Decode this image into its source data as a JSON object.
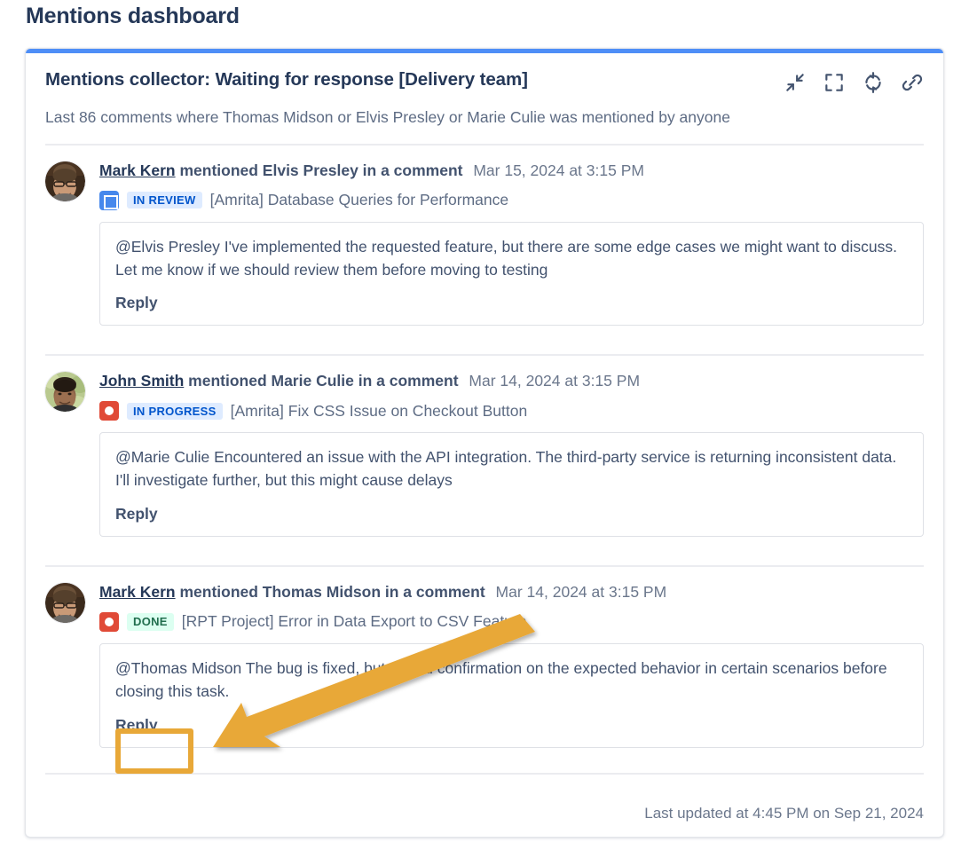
{
  "page": {
    "title": "Mentions dashboard",
    "accent_blue": "#4e8ef7"
  },
  "gadget": {
    "title": "Mentions collector: Waiting for response [Delivery team]",
    "subtitle": "Last 86 comments where Thomas Midson or Elvis Presley or Marie Culie was mentioned by anyone",
    "footer": "Last updated at 4:45 PM on Sep 21, 2024",
    "header_icons": [
      {
        "name": "collapse-icon",
        "label": "Collapse"
      },
      {
        "name": "maximize-icon",
        "label": "Maximize"
      },
      {
        "name": "refresh-icon",
        "label": "Refresh"
      },
      {
        "name": "link-icon",
        "label": "Copy link"
      }
    ]
  },
  "mentions": [
    {
      "user": "Mark Kern",
      "action": "mentioned Elvis Presley in a comment",
      "date": "Mar 15, 2024 at 3:15 PM",
      "issue_type": "story",
      "status": "IN REVIEW",
      "status_color": "#0055cc",
      "status_bg": "#deebff",
      "issue_summary": "[Amrita] Database Queries for Performance",
      "comment": "@Elvis Presley I've implemented the requested feature, but there are some edge cases we might want to discuss. Let me know if we should review them before moving to testing",
      "reply_label": "Reply"
    },
    {
      "user": "John Smith",
      "action": "mentioned Marie Culie in a comment",
      "date": "Mar 14, 2024 at 3:15 PM",
      "issue_type": "bug",
      "status": "IN PROGRESS",
      "status_color": "#0055cc",
      "status_bg": "#deebff",
      "issue_summary": "[Amrita] Fix CSS Issue on Checkout Button",
      "comment": "@Marie Culie Encountered an issue with the API integration. The third-party service is returning inconsistent data. I'll investigate further, but this might cause delays",
      "reply_label": "Reply"
    },
    {
      "user": "Mark Kern",
      "action": "mentioned Thomas Midson in a comment",
      "date": "Mar 14, 2024 at 3:15 PM",
      "issue_type": "bug",
      "status": "DONE",
      "status_color": "#216e4e",
      "status_bg": "#dcfff1",
      "issue_summary": "[RPT Project] Error in Data Export to CSV Feature",
      "comment": "@Thomas Midson The bug is fixed, but I need confirmation on the expected behavior in certain scenarios before closing this task.",
      "reply_label": "Reply"
    }
  ],
  "annotation": {
    "highlight_color": "#e8a838",
    "target": "Reply"
  }
}
